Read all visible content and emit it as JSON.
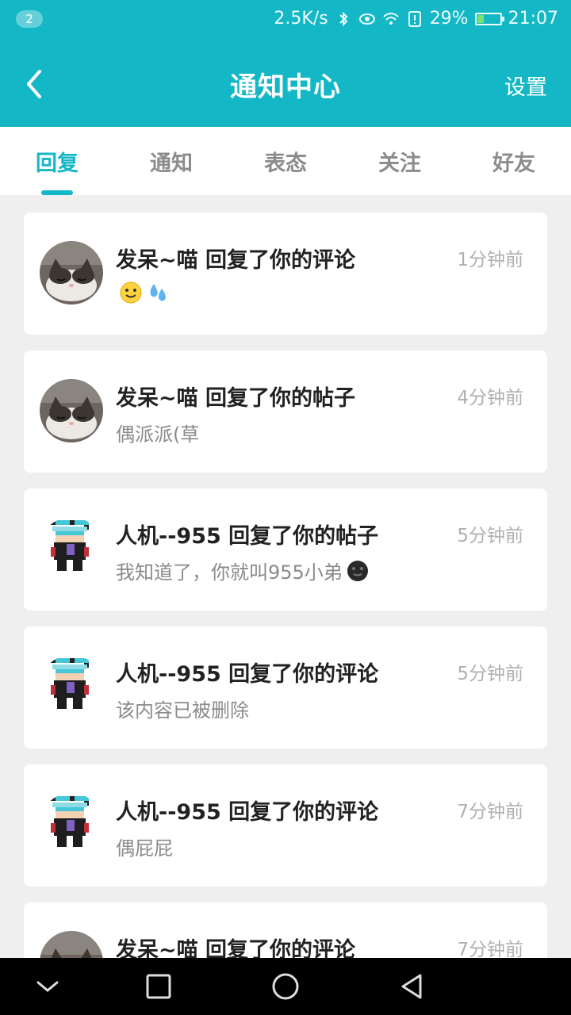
{
  "status": {
    "badge": "2",
    "speed": "2.5K/s",
    "battery": "29%",
    "battery_level": 0.29,
    "time": "21:07",
    "icons": [
      "bluetooth-icon",
      "eye-icon",
      "wifi-icon",
      "sim-alert-icon",
      "battery-icon"
    ]
  },
  "header": {
    "title": "通知中心",
    "settings": "设置",
    "back_icon": "chevron-left-icon",
    "background": "#13b7c6"
  },
  "tabs": [
    {
      "label": "回复",
      "active": true
    },
    {
      "label": "通知",
      "active": false
    },
    {
      "label": "表态",
      "active": false
    },
    {
      "label": "关注",
      "active": false
    },
    {
      "label": "好友",
      "active": false
    }
  ],
  "notifications": [
    {
      "user": "发呆~喵",
      "title": "发呆~喵 回复了你的评论",
      "time": "1分钟前",
      "body": "",
      "emojis": [
        "smile-emoji",
        "sweat-drops-emoji"
      ],
      "avatar": "cat-avatar"
    },
    {
      "user": "发呆~喵",
      "title": "发呆~喵 回复了你的帖子",
      "time": "4分钟前",
      "body": "偶派派(草",
      "emojis": [],
      "avatar": "cat-avatar"
    },
    {
      "user": "人机--955",
      "title": "人机--955 回复了你的帖子",
      "time": "5分钟前",
      "body": "我知道了，你就叫955小弟",
      "emojis": [
        "dark-face-emoji"
      ],
      "avatar": "pixel-avatar"
    },
    {
      "user": "人机--955",
      "title": "人机--955 回复了你的评论",
      "time": "5分钟前",
      "body": "该内容已被删除",
      "emojis": [],
      "avatar": "pixel-avatar"
    },
    {
      "user": "人机--955",
      "title": "人机--955 回复了你的评论",
      "time": "7分钟前",
      "body": "偶屁屁",
      "emojis": [],
      "avatar": "pixel-avatar"
    },
    {
      "user": "发呆~喵",
      "title": "发呆~喵 回复了你的评论",
      "time": "7分钟前",
      "body": "",
      "emojis": [],
      "avatar": "cat-avatar"
    }
  ],
  "system_nav": [
    "collapse-icon",
    "recents-icon",
    "home-icon",
    "back-icon"
  ]
}
